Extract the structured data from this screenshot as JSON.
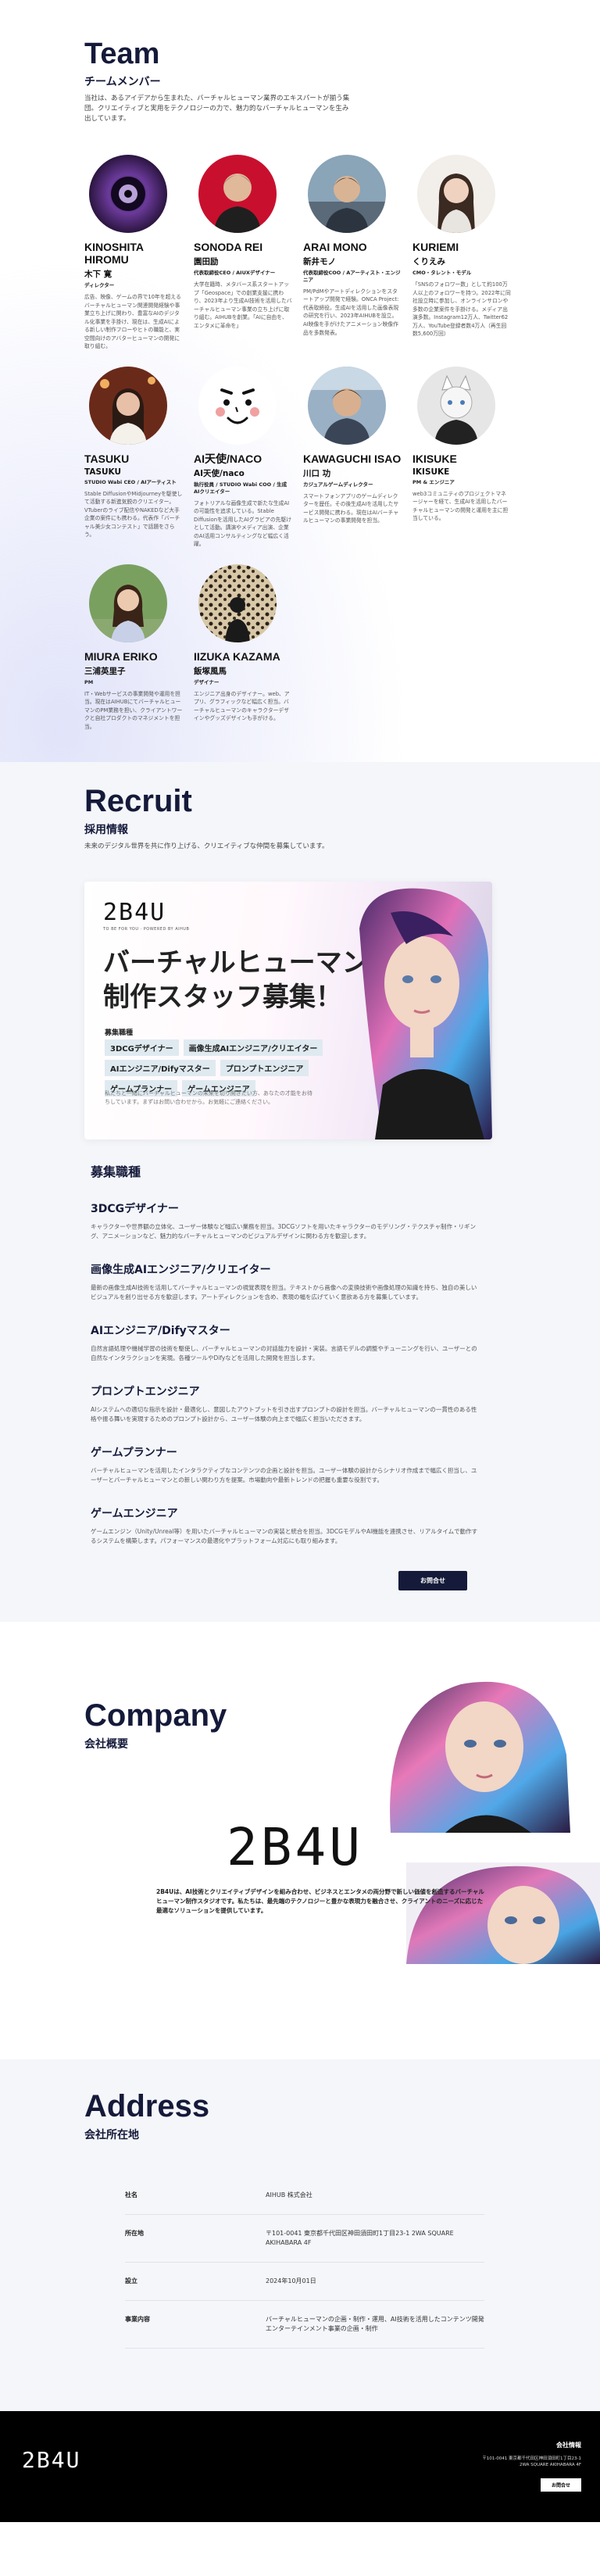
{
  "team": {
    "title": "Team",
    "subtitle": "チームメンバー",
    "description": "当社は、あるアイデアから生まれた、バーチャルヒューマン業界のエキスパートが揃う集団。クリエイティブと実用をテクノロジーの力で、魅力的なバーチャルヒューマンを生み出しています。",
    "members": [
      {
        "name": "KINOSHITA HIROMU",
        "jp": "木下 寛",
        "role": "ディレクター",
        "bio": "広告、映像、ゲームの界で10年を超えるバーチャルヒューマン関連開発経験や事業立ち上げに関わり、豊富なAIのデジタル化事業を手掛け、現在は、生成AIによる新しい制作フローやヒトの職能と、実空間向けのアバターヒューマンの開発に取り組む。"
      },
      {
        "name": "SONODA REI",
        "jp": "園田励",
        "role": "代表取締役CEO / AIUXデザイナー",
        "bio": "大学在籍時、メタバース系スタートアップ「Geospace」での創業支援に携わり、2023年より生成AI技術を活用したバーチャルヒューマン事業の立ち上げに取り組む。AIHUBを創業。「AIに自由を、エンタメに革命を」"
      },
      {
        "name": "ARAI MONO",
        "jp": "新井モノ",
        "role": "代表取締役COO / Aアーティスト・エンジニア",
        "bio": "PM/PdMやアートディレクションをスタートアップ開発で経験。ONCA Project:代表取締役。生成AIを活用した画像表現の研究を行い、2023年AIHUBを設立。AI映像を手がけたアニメーション映像作品を多数発表。"
      },
      {
        "name": "KURIEMI",
        "jp": "くりえみ",
        "role": "CMO・タレント・モデル",
        "bio": "「SNSのフォロワー数」として約100万人以上のフォロワーを持つ。2022年に同社設立時に参加し、オンラインサロンや多数の企業案件を手掛ける。メディア出演多数。Instagram12万人、Twitter62万人、YouTube登録者数4万人（再生回数5,600万回）"
      },
      {
        "name": "TASUKU",
        "jp": "TASUKU",
        "role": "STUDIO Wabi CEO / AIアーティスト",
        "bio": "Stable DiffusionやMidjourneyを駆使して活動する新進気鋭のクリエイター。VTuberのライブ配信やNAKEDなど大手企業の案件にも携わる。代表作「バーチャル美少女コンテスト」で話題をさらう。"
      },
      {
        "name": "AI天使/naco",
        "jp": "AI天使/naco",
        "role": "執行役員 / STUDIO Wabi COO / 生成AIクリエイター",
        "bio": "フォトリアルな画像生成で新たな生成AIの可能性を追求している。Stable Diffusionを活用したAIグラビアの先駆けとして活動。講演やメディア出演、企業のAI活用コンサルティングなど幅広く活躍。"
      },
      {
        "name": "KAWAGUCHI ISAO",
        "jp": "川口 功",
        "role": "カジュアルゲームディレクター",
        "bio": "スマートフォンアプリのゲームディレクターを歴任。その後生成AIを活用したサービス開発に携わる。現在はAIバーチャルヒューマンの事業開発を担当。"
      },
      {
        "name": "IKISUKE",
        "jp": "IKISUKE",
        "role": "PM & エンジニア",
        "bio": "web3コミュニティのプロジェクトマネージャーを経て、生成AIを活用したバーチャルヒューマンの開発と運用を主に担当している。"
      },
      {
        "name": "MIURA ERIKO",
        "jp": "三浦英里子",
        "role": "PM",
        "bio": "IT・Webサービスの事業開発や運用を担当。現在はAIHUBにてバーチャルヒューマンのPM業務を担い、クライアントワークと自社プロダクトのマネジメントを担当。"
      },
      {
        "name": "IIZUKA KAZAMA",
        "jp": "飯塚風馬",
        "role": "デザイナー",
        "bio": "エンジニア出身のデザイナー。web、アプリ、グラフィックなど幅広く担当。バーチャルヒューマンのキャラクターデザインやグッズデザインも手がける。"
      }
    ]
  },
  "recruit": {
    "title": "Recruit",
    "subtitle": "採用情報",
    "description": "未来のデジタル世界を共に作り上げる、クリエイティブな仲間を募集しています。",
    "banner": {
      "logo": "2B4U",
      "logo_sub": "TO BE FOR YOU · POWERED BY AIHUB",
      "title": "バーチャルヒューマン制作スタッフ募集！",
      "tags_label": "募集職種",
      "tags": [
        "3DCGデザイナー",
        "画像生成AIエンジニア/クリエイター",
        "AIエンジニア/Difyマスター",
        "プロンプトエンジニア",
        "ゲームプランナー",
        "ゲームエンジニア"
      ],
      "note": "私たちと一緒にバーチャルヒューマンの未来を切り開きたい方、あなたの才能をお待ちしています。まずはお問い合わせから。お気軽にご連絡ください。"
    },
    "jobs_title": "募集職種",
    "jobs": [
      {
        "title": "3DCGデザイナー",
        "desc": "キャラクターや世界観の立体化、ユーザー体験など幅広い業務を担当。3DCGソフトを用いたキャラクターのモデリング・テクスチャ制作・リギング、アニメーションなど、魅力的なバーチャルヒューマンのビジュアルデザインに関わる方を歓迎します。"
      },
      {
        "title": "画像生成AIエンジニア/クリエイター",
        "desc": "最新の画像生成AI技術を活用してバーチャルヒューマンの視覚表現を担当。テキストから画像への変換技術や画像処理の知識を持ち、独自の美しいビジュアルを創り出せる方を歓迎します。アートディレクションを含め、表現の幅を広げていく意欲ある方を募集しています。"
      },
      {
        "title": "AIエンジニア/Difyマスター",
        "desc": "自然言語処理や機械学習の技術を駆使し、バーチャルヒューマンの対話能力を設計・実装。言語モデルの調整やチューニングを行い、ユーザーとの自然なインタラクションを実現。各種ツールやDifyなどを活用した開発を担当します。"
      },
      {
        "title": "プロンプトエンジニア",
        "desc": "AIシステムへの適切な指示を設計・最適化し、意図したアウトプットを引き出すプロンプトの設計を担当。バーチャルヒューマンの一貫性のある性格や振る舞いを実現するためのプロンプト設計から、ユーザー体験の向上まで幅広く担当いただきます。"
      },
      {
        "title": "ゲームプランナー",
        "desc": "バーチャルヒューマンを活用したインタラクティブなコンテンツの企画と設計を担当。ユーザー体験の設計からシナリオ作成まで幅広く担当し、ユーザーとバーチャルヒューマンとの新しい関わり方を提案。市場動向や最新トレンドの把握も重要な役割です。"
      },
      {
        "title": "ゲームエンジニア",
        "desc": "ゲームエンジン（Unity/Unreal等）を用いたバーチャルヒューマンの実装と統合を担当。3DCGモデルやAI機能を連携させ、リアルタイムで動作するシステムを構築します。パフォーマンスの最適化やプラットフォーム対応にも取り組みます。"
      }
    ],
    "cta": "お問合せ"
  },
  "company": {
    "title": "Company",
    "subtitle": "会社概要",
    "logo": "2B4U",
    "text": "2B4Uは、AI技術とクリエイティブデザインを組み合わせ、ビジネスとエンタメの両分野で新しい価値を創造するバーチャルヒューマン制作スタジオです。私たちは、最先端のテクノロジーと豊かな表現力を融合させ、クライアントのニーズに応じた最適なソリューションを提供しています。"
  },
  "address": {
    "title": "Address",
    "subtitle": "会社所在地",
    "rows": [
      {
        "k": "社名",
        "v": "AIHUB 株式会社"
      },
      {
        "k": "所在地",
        "v": "〒101-0041 東京都千代田区神田須田町1丁目23-1 2WA SQUARE AKIHABARA 4F"
      },
      {
        "k": "設立",
        "v": "2024年10月01日"
      },
      {
        "k": "事業内容",
        "v": "バーチャルヒューマンの企画・制作・運用、AI技術を活用したコンテンツ開発エンターテインメント事業の企画・制作"
      }
    ]
  },
  "footer": {
    "logo": "2B4U",
    "company": "会社情報",
    "address": "〒101-0041 東京都千代田区神田須田町1丁目23-1 2WA SQUARE AKIHABARA 4F",
    "button": "お問合せ"
  },
  "colors": {
    "navy": "#151a3a",
    "tag_bg": "#dfeaf0",
    "section_bg": "#f4f6fa"
  }
}
